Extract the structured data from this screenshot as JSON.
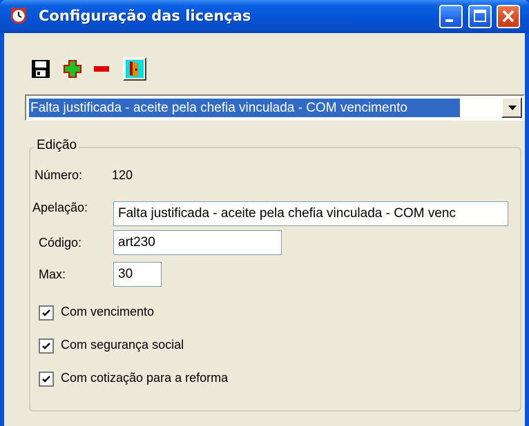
{
  "window": {
    "title": "Configuração das licenças"
  },
  "toolbar": {
    "buttons": [
      {
        "name": "save",
        "icon": "floppy-disk-icon"
      },
      {
        "name": "add",
        "icon": "plus-icon"
      },
      {
        "name": "remove",
        "icon": "minus-icon"
      },
      {
        "name": "exit",
        "icon": "door-exit-icon"
      }
    ]
  },
  "license_select": {
    "selected": "Falta justificada - aceite pela chefia vinculada - COM vencimento"
  },
  "edit": {
    "group_label": "Edição",
    "numero_label": "Número:",
    "numero_value": "120",
    "apelacao_label": "Apelação:",
    "apelacao_value": "Falta justificada - aceite pela chefia vinculada - COM venc",
    "codigo_label": "Código:",
    "codigo_value": "art230",
    "max_label": "Max:",
    "max_value": "30",
    "checkboxes": [
      {
        "label": "Com vencimento",
        "checked": true
      },
      {
        "label": "Com segurança social",
        "checked": true
      },
      {
        "label": "Com cotização para a reforma",
        "checked": true
      }
    ]
  },
  "colors": {
    "titlebar": "#0553d6",
    "window_bg": "#ece9d8",
    "selection": "#316ac5",
    "close_button": "#d84a22"
  }
}
